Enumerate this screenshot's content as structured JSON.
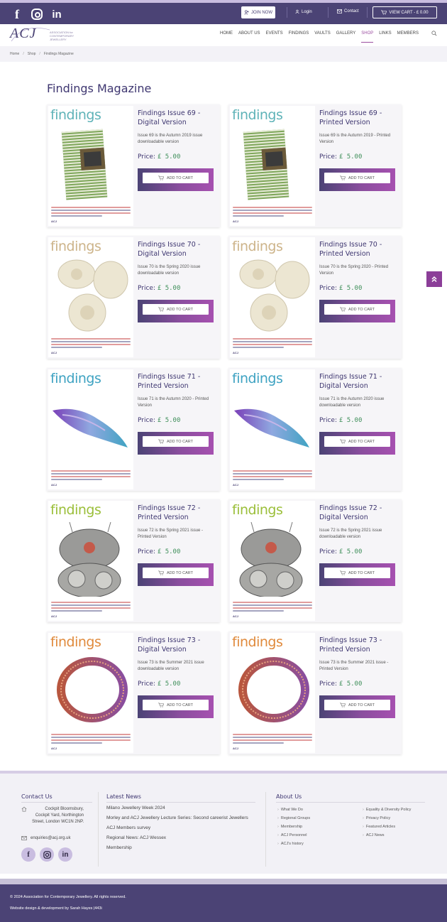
{
  "topbar": {
    "social": [
      "f",
      "ig",
      "in"
    ],
    "join_label": "JOIN NOW",
    "login_label": "Login",
    "contact_label": "Contact",
    "cart_label": "VIEW CART - £ 0.00"
  },
  "logo": {
    "text": "ACJ",
    "subtitle": "ASSOCIATION for CONTEMPORARY JEWELLERY"
  },
  "nav": {
    "items": [
      "HOME",
      "ABOUT US",
      "EVENTS",
      "FINDINGS",
      "VAULTS",
      "GALLERY",
      "SHOP",
      "LINKS",
      "MEMBERS"
    ],
    "active": "SHOP"
  },
  "breadcrumb": [
    "Home",
    "Shop",
    "Findings Magazine"
  ],
  "page_title": "Findings Magazine",
  "products": [
    {
      "title": "Findings Issue 69 - Digital Version",
      "desc": "Issue 69 is the Autumn 2019 issue downloadable version",
      "price_label": "Price:",
      "price": "£ 5.00",
      "button": "ADD TO CART"
    },
    {
      "title": "Findings Issue 69 - Printed Version",
      "desc": "Issue 69 is the Autumn 2019 - Printed Version",
      "price_label": "Price:",
      "price": "£ 5.00",
      "button": "ADD TO CART"
    },
    {
      "title": "Findings Issue 70 - Digital Version",
      "desc": "Issue 70 is the Spring 2020 issue downloadable version",
      "price_label": "Price:",
      "price": "£ 5.00",
      "button": "ADD TO CART"
    },
    {
      "title": "Findings Issue 70 - Printed Version",
      "desc": "Issue 70 is the Spring 2020 - Printed Version",
      "price_label": "Price:",
      "price": "£ 5.00",
      "button": "ADD TO CART"
    },
    {
      "title": "Findings Issue 71 - Printed Version",
      "desc": "Issue 71 is the Autumn 2020 - Printed Version",
      "price_label": "Price:",
      "price": "£ 5.00",
      "button": "ADD TO CART"
    },
    {
      "title": "Findings Issue 71 - Digital Version",
      "desc": "Issue 71 is the Autumn 2020 issue downloadable version",
      "price_label": "Price:",
      "price": "£ 5.00",
      "button": "ADD TO CART"
    },
    {
      "title": "Findings Issue 72 - Printed Version",
      "desc": "Issue 72 is the Spring 2021 issue - Printed Version",
      "price_label": "Price:",
      "price": "£ 5.00",
      "button": "ADD TO CART"
    },
    {
      "title": "Findings Issue 72 - Digital Version",
      "desc": "Issue 72 is the Spring 2021 issue downloadable version",
      "price_label": "Price:",
      "price": "£ 5.00",
      "button": "ADD TO CART"
    },
    {
      "title": "Findings Issue 73 - Digital Version",
      "desc": "Issue 73 is the Summer 2021 issue downloadable version",
      "price_label": "Price:",
      "price": "£ 5.00",
      "button": "ADD TO CART"
    },
    {
      "title": "Findings Issue 73 - Printed Version",
      "desc": "Issue 73 is the Summer 2021 issue - Printed Version",
      "price_label": "Price:",
      "price": "£ 5.00",
      "button": "ADD TO CART"
    }
  ],
  "cover": {
    "masthead": "findings",
    "footer_text": "ACJ"
  },
  "cover_colors": [
    "#5fb3b8",
    "#cdb48a",
    "#3fa3c2",
    "#9bbf3a",
    "#e08a3c"
  ],
  "footer": {
    "contact_heading": "Contact Us",
    "address": "Cockpit Bloomsbury, Cockpit Yard, Northington Street, London WC1N 2NP.",
    "email": "enquiries@acj.org.uk",
    "social": [
      "f",
      "ig",
      "in"
    ],
    "news_heading": "Latest News",
    "news": [
      "Milano Jewellery Week 2024",
      "Morley and ACJ Jewellery Lecture Series: Second careerist Jewellers",
      "ACJ Members survey",
      "Regional News: ACJ Wessex",
      "Membership"
    ],
    "about_heading": "About Us",
    "about_col1": [
      "What We Do",
      "Regional Groups",
      "Membership",
      "ACJ Personnel",
      "ACJ's history"
    ],
    "about_col2": [
      "Equality & Diversity Policy",
      "Privacy Policy",
      "Featured Articles",
      "ACJ News"
    ]
  },
  "bottom": {
    "copyright": "© 2024 Association for Contemporary Jewellery. All rights reserved.",
    "credit": "Website design & development by Sarah Hayes |443i"
  },
  "colors": {
    "brand_purple": "#4b4375",
    "accent_magenta": "#9b4ea0",
    "price_green": "#3f8f5a"
  }
}
